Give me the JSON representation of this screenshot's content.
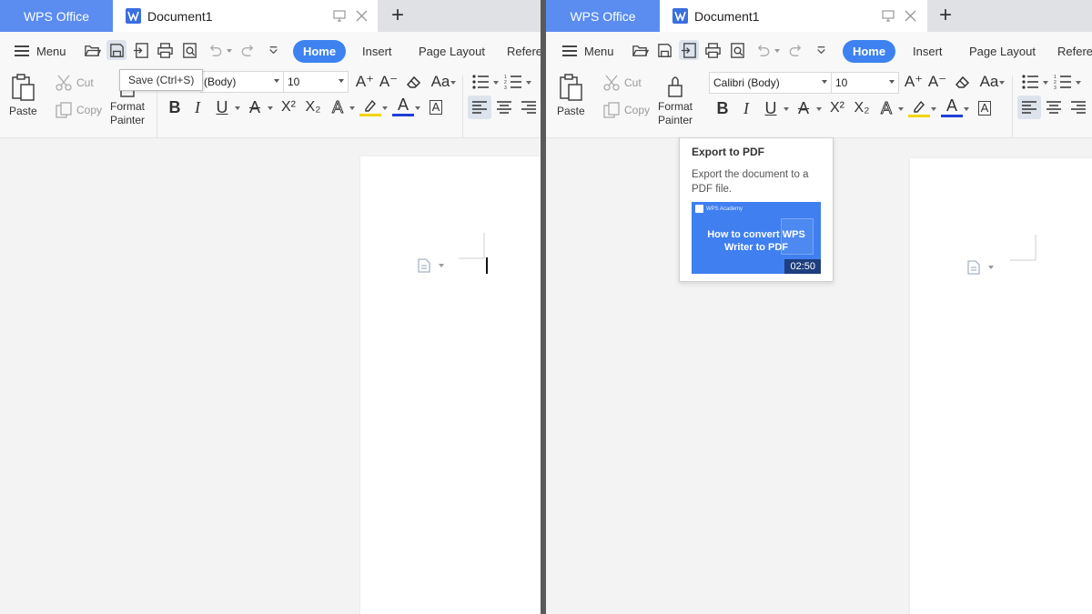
{
  "titlebar": {
    "app_tab": "WPS Office",
    "doc_tab": "Document1",
    "new_tab": "+"
  },
  "quickbar": {
    "menu_label": "Menu"
  },
  "menu_tabs": {
    "home": "Home",
    "insert": "Insert",
    "page_layout": "Page Layout",
    "references": "Refere"
  },
  "ribbon": {
    "paste": "Paste",
    "cut": "Cut",
    "copy": "Copy",
    "format_painter_line1": "Format",
    "format_painter_line2": "Painter",
    "font_name_left": "(Body)",
    "font_name_right": "Calibri (Body)",
    "font_size": "10",
    "increase_font": "A⁺",
    "decrease_font": "A⁻",
    "change_case": "Aa",
    "bold": "B",
    "italic": "I",
    "underline": "U",
    "strikethrough": "A",
    "superscript": "X²",
    "subscript": "X₂",
    "text_effect": "A",
    "highlight": "✎",
    "font_color": "A",
    "char_border": "A"
  },
  "tooltips": {
    "save": "Save (Ctrl+S)",
    "export_title": "Export to PDF",
    "export_desc": "Export the document to a PDF file.",
    "video_brand": "WPS Academy",
    "video_title": "How to convert WPS Writer to PDF",
    "video_duration": "02:50"
  },
  "colors": {
    "accent": "#3d82f0",
    "app_tab": "#5b8cf0",
    "highlight": "#f2d400",
    "font_color": "#1f3fd8"
  }
}
